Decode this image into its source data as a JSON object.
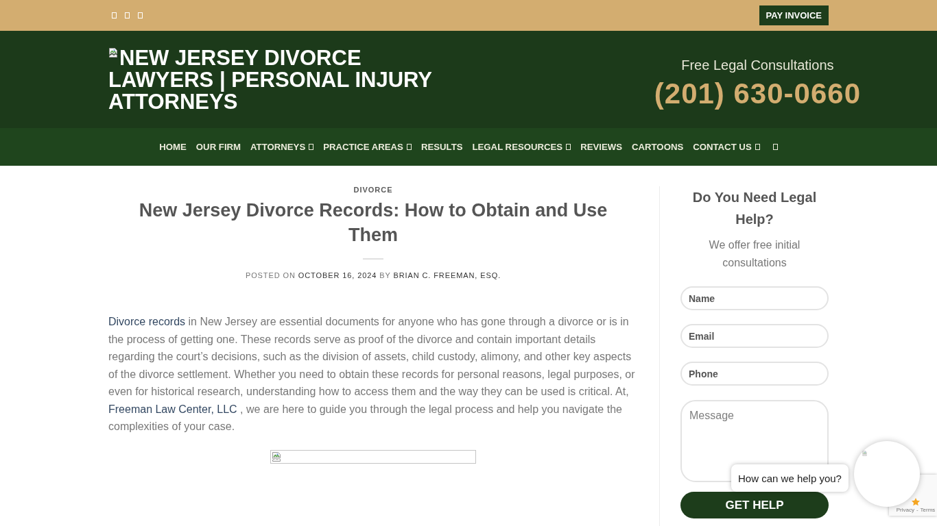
{
  "top_bar": {
    "button": "PAY INVOICE"
  },
  "header": {
    "logo": "NEW JERSEY DIVORCE LAWYERS | PERSONAL INJURY ATTORNEYS",
    "tagline": "Free Legal Consultations",
    "phone": "(201) 630-0660"
  },
  "nav": {
    "items": [
      {
        "label": "HOME",
        "dropdown": false
      },
      {
        "label": "OUR FIRM",
        "dropdown": false
      },
      {
        "label": "ATTORNEYS",
        "dropdown": true
      },
      {
        "label": "PRACTICE AREAS",
        "dropdown": true
      },
      {
        "label": "RESULTS",
        "dropdown": false
      },
      {
        "label": "LEGAL RESOURCES",
        "dropdown": true
      },
      {
        "label": "REVIEWS",
        "dropdown": false
      },
      {
        "label": "CARTOONS",
        "dropdown": false
      },
      {
        "label": "CONTACT US",
        "dropdown": true
      }
    ]
  },
  "article": {
    "category": "DIVORCE",
    "title": "New Jersey Divorce Records: How to Obtain and Use Them",
    "meta": [
      {
        "kind": "text",
        "text": "POSTED ON "
      },
      {
        "kind": "link",
        "text": "OCTOBER 16, 2024"
      },
      {
        "kind": "text",
        "text": " BY "
      },
      {
        "kind": "link",
        "text": "BRIAN C. FREEMAN, ESQ."
      }
    ],
    "body": [
      {
        "kind": "link",
        "text": "Divorce records"
      },
      {
        "kind": "text",
        "text": " in New Jersey are essential documents for anyone who has gone through a divorce or is in the process of getting one. These records serve as proof of the divorce and contain important details regarding the court’s decisions, such as the division of assets, child custody, alimony, and other key aspects of the divorce settlement. Whether you need to obtain these records for personal reasons, legal purposes, or even for historical research, understanding how to access them and the way they can be used is critical. At, "
      },
      {
        "kind": "link",
        "text": "Freeman Law Center, LLC"
      },
      {
        "kind": "text",
        "text": " , we are here to guide you through the legal process and help you navigate the complexities of your case."
      }
    ]
  },
  "sidebar": {
    "heading": "Do You Need Legal Help?",
    "subheading": "We offer free initial consultations",
    "fields": [
      {
        "kind": "input",
        "placeholder": "Name"
      },
      {
        "kind": "input",
        "placeholder": "Email"
      },
      {
        "kind": "input",
        "placeholder": "Phone"
      },
      {
        "kind": "textarea",
        "placeholder": "Message"
      }
    ],
    "button": "GET HELP"
  },
  "chat": {
    "bubble": "How can we help you?"
  },
  "recaptcha": {
    "links": [
      "Privacy",
      "Terms"
    ],
    "separator": "-"
  }
}
